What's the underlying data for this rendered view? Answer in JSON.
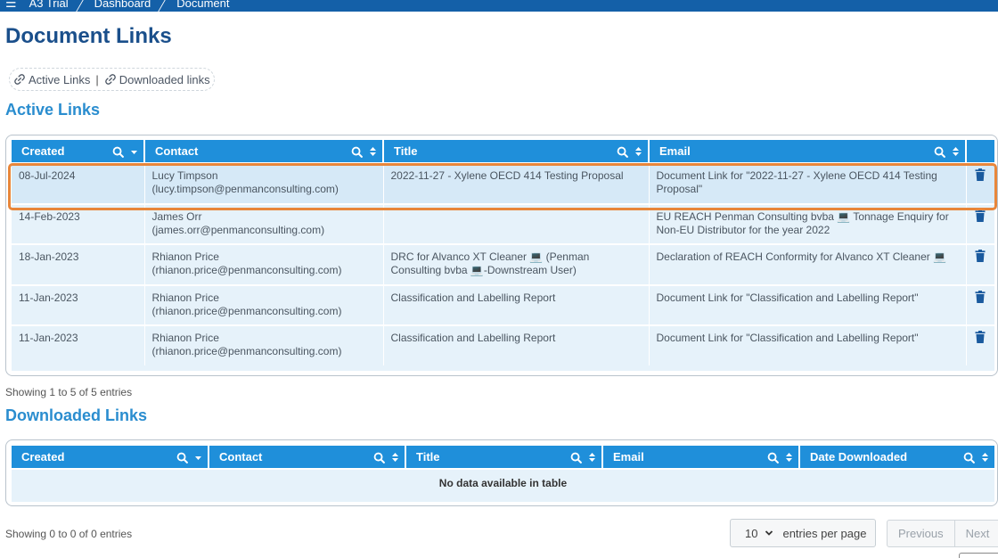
{
  "breadcrumb": {
    "items": [
      "A3 Trial",
      "Dashboard",
      "Document"
    ]
  },
  "page_title": "Document Links",
  "link_pills": {
    "active": "Active Links",
    "separator": "|",
    "downloaded": "Downloaded links"
  },
  "active": {
    "title": "Active Links",
    "columns": [
      "Created",
      "Contact",
      "Title",
      "Email"
    ],
    "rows": [
      {
        "created": "08-Jul-2024",
        "contact_name": "Lucy Timpson",
        "contact_email": "(lucy.timpson@penmanconsulting.com)",
        "title": "2022-11-27 - Xylene OECD 414 Testing Proposal",
        "email": "Document Link for \"2022-11-27 - Xylene OECD 414 Testing Proposal\""
      },
      {
        "created": "14-Feb-2023",
        "contact_name": "James Orr (james.orr@penmanconsulting.com)",
        "contact_email": "",
        "title": "",
        "email": "EU REACH Penman Consulting bvba 💻 Tonnage Enquiry for Non-EU Distributor for the year 2022"
      },
      {
        "created": "18-Jan-2023",
        "contact_name": "Rhianon Price",
        "contact_email": "(rhianon.price@penmanconsulting.com)",
        "title": "DRC for Alvanco XT Cleaner 💻 (Penman Consulting bvba 💻-Downstream User)",
        "email": "Declaration of REACH Conformity for Alvanco XT Cleaner 💻"
      },
      {
        "created": "11-Jan-2023",
        "contact_name": "Rhianon Price",
        "contact_email": "(rhianon.price@penmanconsulting.com)",
        "title": "Classification and Labelling Report",
        "email": "Document Link for \"Classification and Labelling Report\""
      },
      {
        "created": "11-Jan-2023",
        "contact_name": "Rhianon Price",
        "contact_email": "(rhianon.price@penmanconsulting.com)",
        "title": "Classification and Labelling Report",
        "email": "Document Link for \"Classification and Labelling Report\""
      }
    ],
    "info": "Showing 1 to 5 of 5 entries"
  },
  "downloaded": {
    "title": "Downloaded Links",
    "columns": [
      "Created",
      "Contact",
      "Title",
      "Email",
      "Date Downloaded"
    ],
    "empty": "No data available in table",
    "info": "Showing 0 to 0 of 0 entries"
  },
  "pager": {
    "page_size": "10",
    "page_size_label": "entries per page",
    "previous": "Previous",
    "next": "Next"
  },
  "colors": {
    "topbar": "#1460a8",
    "title": "#1a4f8b",
    "section": "#2a8dcf",
    "header": "#1f8fda",
    "highlight": "#e8863a",
    "trash": "#1a5a9e"
  },
  "icons": {
    "search": "search-icon",
    "sort": "sort-icon",
    "sort_desc": "sort-desc-icon",
    "link": "link-icon",
    "trash": "trash-icon",
    "menu": "menu-icon",
    "chevron": "chevron-down-icon"
  }
}
